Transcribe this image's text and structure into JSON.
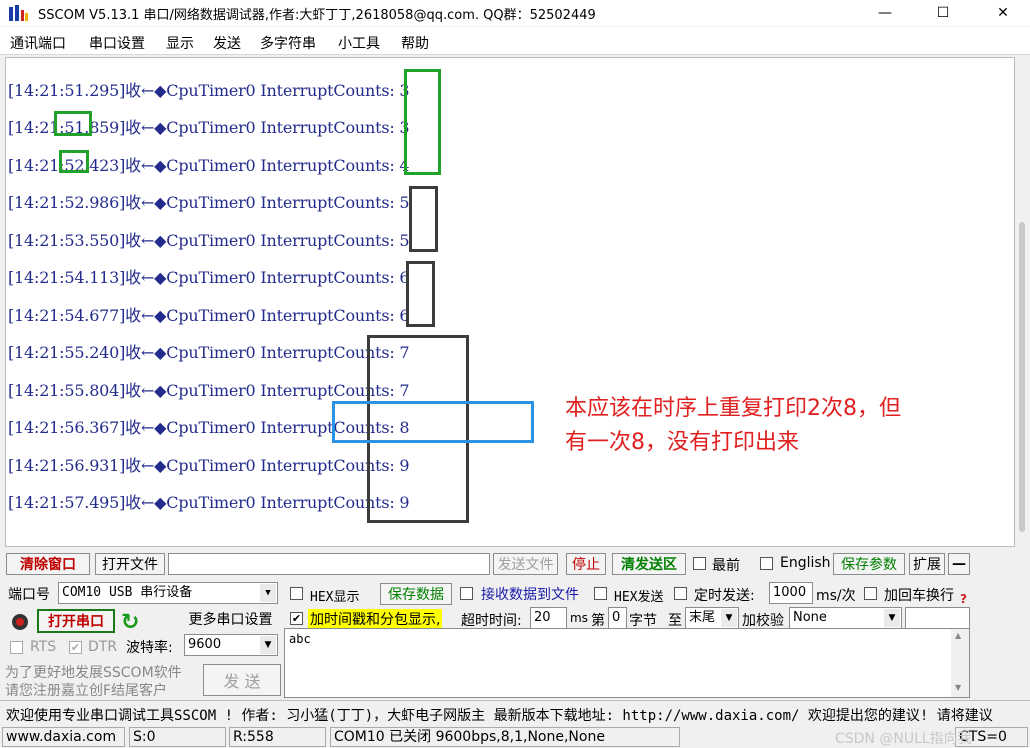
{
  "window": {
    "title": "SSCOM V5.13.1 串口/网络数据调试器,作者:大虾丁丁,2618058@qq.com. QQ群：52502449",
    "minimize": "—",
    "maximize": "☐",
    "close": "✕"
  },
  "menu": [
    "通讯端口",
    "串口设置",
    "显示",
    "发送",
    "多字符串",
    "小工具",
    "帮助"
  ],
  "log_lines": [
    "[14:21:51.295]收←◆CpuTimer0 InterruptCounts: 3",
    "[14:21:51.859]收←◆CpuTimer0 InterruptCounts: 3",
    "[14:21:52.423]收←◆CpuTimer0 InterruptCounts: 4",
    "[14:21:52.986]收←◆CpuTimer0 InterruptCounts: 5",
    "[14:21:53.550]收←◆CpuTimer0 InterruptCounts: 5",
    "[14:21:54.113]收←◆CpuTimer0 InterruptCounts: 6",
    "[14:21:54.677]收←◆CpuTimer0 InterruptCounts: 6",
    "[14:21:55.240]收←◆CpuTimer0 InterruptCounts: 7",
    "[14:21:55.804]收←◆CpuTimer0 InterruptCounts: 7",
    "[14:21:56.367]收←◆CpuTimer0 InterruptCounts: 8",
    "[14:21:56.931]收←◆CpuTimer0 InterruptCounts: 9",
    "[14:21:57.495]收←◆CpuTimer0 InterruptCounts: 9"
  ],
  "annotation": {
    "line1": "本应该在时序上重复打印2次8，但",
    "line2": "有一次8，没有打印出来"
  },
  "toolbar": {
    "clear_window": "清除窗口",
    "open_file": "打开文件",
    "file_path": "",
    "send_file": "发送文件",
    "stop": "停止",
    "clear_send": "清发送区",
    "latest": "最前",
    "english": "English",
    "save_params": "保存参数",
    "expand": "扩展",
    "collapse": "—"
  },
  "port": {
    "port_label": "端口号",
    "port_value": "COM10 USB 串行设备",
    "hex_display": "HEX显示",
    "save_data": "保存数据",
    "receive_to_file": "接收数据到文件",
    "hex_send": "HEX发送",
    "timed_send": "定时发送:",
    "interval": "1000",
    "interval_unit": "ms/次",
    "add_crlf": "加回车换行",
    "help_mark": "?",
    "open_port": "打开串口",
    "more_settings": "更多串口设置",
    "timestamp_option": "加时间戳和分包显示,",
    "timeout_label": "超时时间:",
    "timeout_value": "20",
    "timeout_unit": "ms",
    "nth_label": "第",
    "nth_value": "0",
    "byte_label": "字节",
    "to_label": "至",
    "end_value": "末尾",
    "checksum_label": "加校验",
    "checksum_value": "None",
    "rts": "RTS",
    "dtr": "DTR",
    "baud_label": "波特率:",
    "baud_value": "9600",
    "send_text": "abc",
    "send_button": "发 送",
    "promo1": "为了更好地发展SSCOM软件",
    "promo2": "请您注册嘉立创F结尾客户"
  },
  "ad": "欢迎使用专业串口调试工具SSCOM !  作者: 习小猛(丁丁)，大虾电子网版主  最新版本下载地址: http://www.daxia.com/ 欢迎提出您的建议! 请将建议",
  "status": {
    "website": "www.daxia.com",
    "sent": "S:0",
    "received": "R:558",
    "port_state": "COM10 已关闭  9600bps,8,1,None,None",
    "cts": "CTS=0"
  },
  "watermark": "CSDN @NULL指向我",
  "colors": {
    "log_text": "#232c8c",
    "annotation_red": "#e02020",
    "box_green": "#22a12b",
    "box_dark": "#3c3c3c",
    "box_blue": "#2b93e6"
  }
}
